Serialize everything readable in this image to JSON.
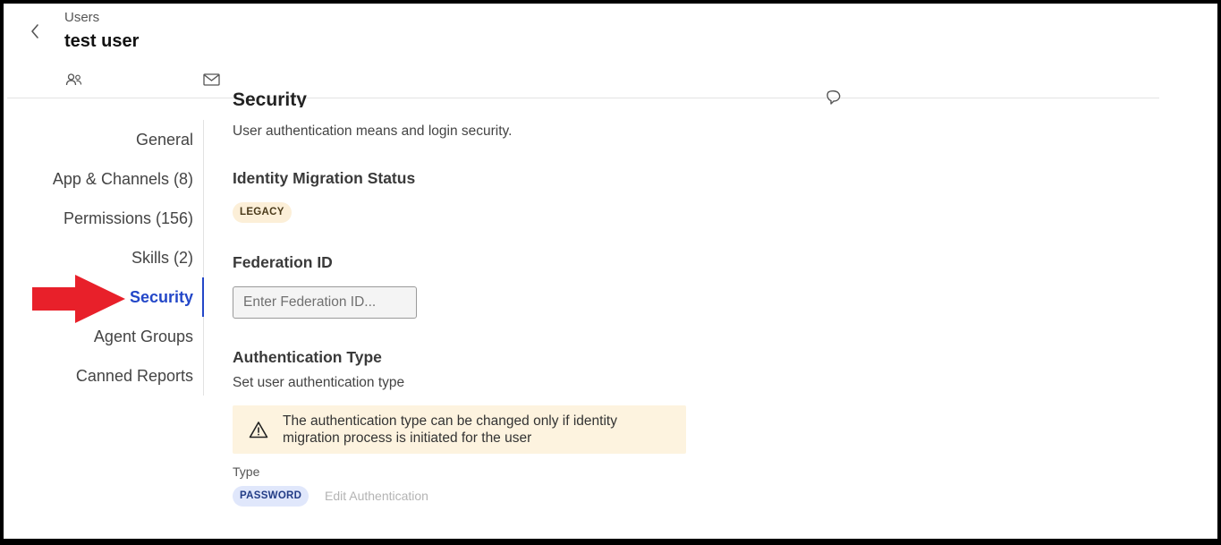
{
  "header": {
    "breadcrumb": "Users",
    "title": "test user",
    "icons": [
      "back-chevron-icon",
      "users-icon",
      "mail-icon"
    ]
  },
  "side_nav": {
    "items": [
      {
        "label": "General",
        "active": false
      },
      {
        "label": "App & Channels (8)",
        "active": false
      },
      {
        "label": "Permissions (156)",
        "active": false
      },
      {
        "label": "Skills (2)",
        "active": false
      },
      {
        "label": "Security",
        "active": true
      },
      {
        "label": "Agent Groups",
        "active": false
      },
      {
        "label": "Canned Reports",
        "active": false
      }
    ],
    "active_color": "#2347c8"
  },
  "annotation": {
    "arrow_color": "#e8202a",
    "icon": "red-arrow-icon"
  },
  "content": {
    "section_title": "Security",
    "description": "User authentication means and login security.",
    "identity_migration": {
      "heading": "Identity Migration Status",
      "badge": "LEGACY"
    },
    "federation": {
      "heading": "Federation ID",
      "placeholder": "Enter Federation ID...",
      "value": ""
    },
    "authentication": {
      "heading": "Authentication Type",
      "subtitle": "Set user authentication type",
      "warning": "The authentication type can be changed only if identity migration process is initiated for the user",
      "type_label": "Type",
      "type_badge": "PASSWORD",
      "edit_link": "Edit Authentication"
    }
  }
}
